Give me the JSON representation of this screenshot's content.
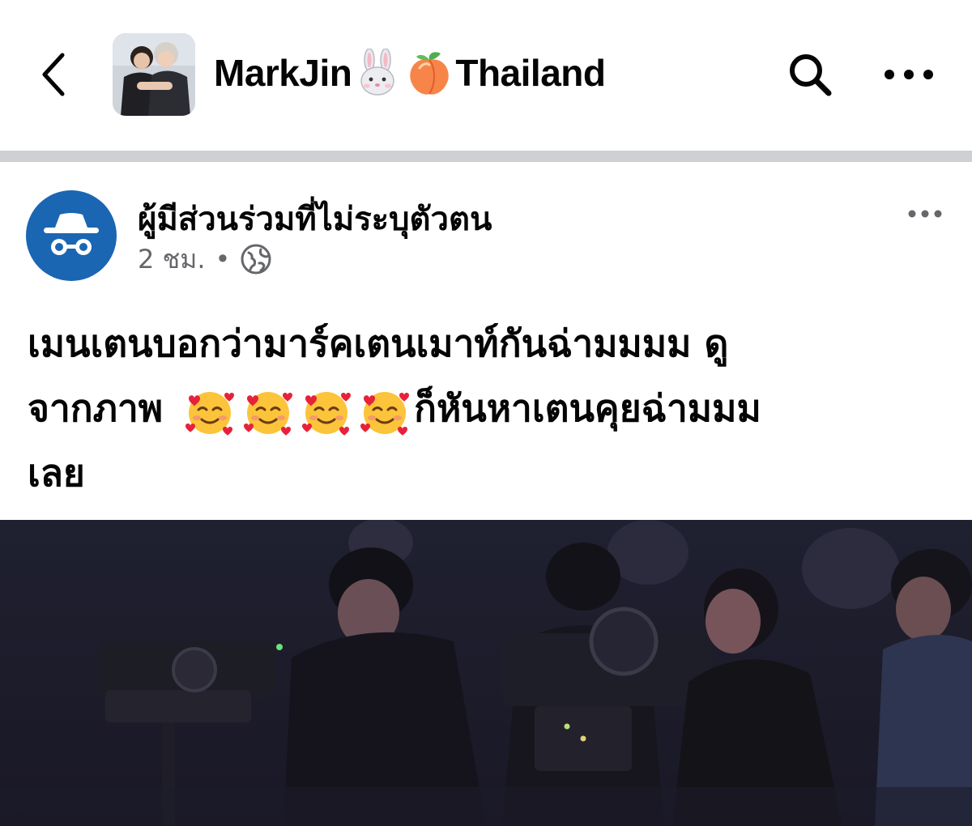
{
  "header": {
    "group_name_part1": "MarkJin",
    "group_name_part2": "Thailand",
    "icons": [
      "back-arrow-icon",
      "rabbit-face-icon",
      "peach-icon",
      "search-icon",
      "more-icon"
    ]
  },
  "post": {
    "author": "ผู้มีส่วนร่วมที่ไม่ระบุตัวตน",
    "time": "2 ชม.",
    "separator": "•",
    "text_line1": "เมนเตนบอกว่ามาร์คเตนเมาท์กันฉ่ามมมม ดู",
    "text_line2_start": "จากภาพ",
    "text_line2_end": "ก็หันหาเตนคุยฉ่ามมม",
    "text_line3": "เลย",
    "icons": [
      "anonymous-avatar-icon",
      "globe-icon",
      "smiling-face-with-hearts-icon",
      "more-icon"
    ]
  },
  "colors": {
    "divider": "#ced0d4",
    "avatar_blue": "#1a66b3",
    "meta_gray": "#65676b",
    "photo_bg": "#1b1a2b"
  }
}
